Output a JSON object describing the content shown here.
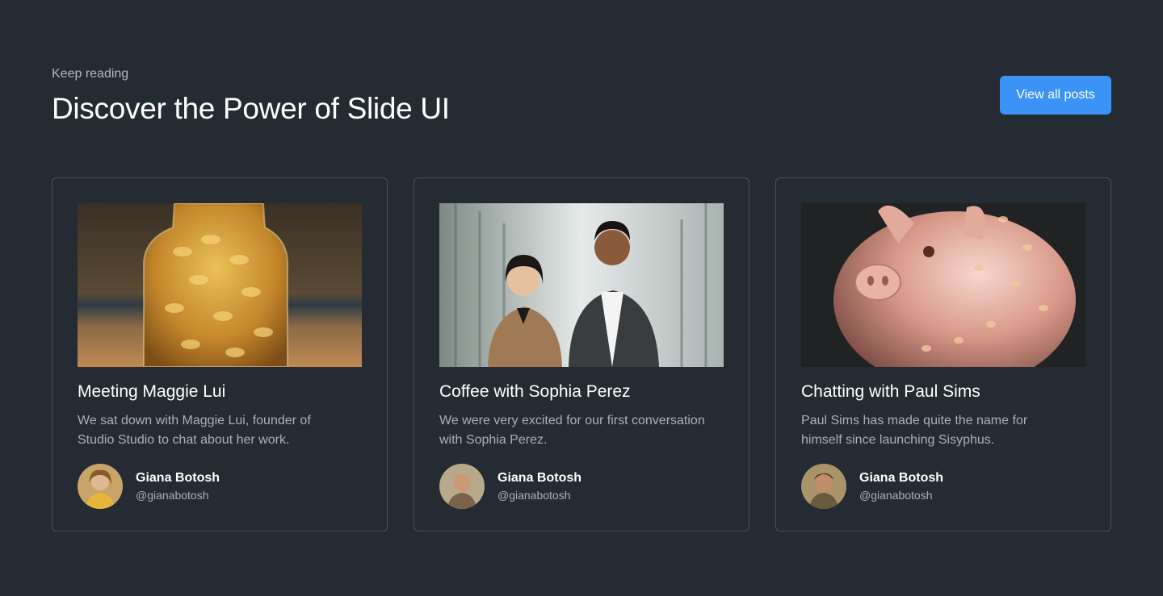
{
  "header": {
    "eyebrow": "Keep reading",
    "title": "Discover the Power of Slide UI",
    "view_all_label": "View all posts"
  },
  "colors": {
    "background": "#252b33",
    "accent": "#3b93f5",
    "card_border": "#4a5159",
    "muted_text": "#aab0b8"
  },
  "cards": [
    {
      "image": "coin-jar-photo",
      "title": "Meeting Maggie Lui",
      "description": "We sat down with Maggie Lui, founder of Studio Studio to chat about her work.",
      "author_name": "Giana Botosh",
      "author_handle": "@gianabotosh"
    },
    {
      "image": "business-people-photo",
      "title": "Coffee with Sophia Perez",
      "description": "We were very excited for our first conversation with Sophia Perez.",
      "author_name": "Giana Botosh",
      "author_handle": "@gianabotosh"
    },
    {
      "image": "piggy-bank-photo",
      "title": "Chatting with Paul Sims",
      "description": "Paul Sims has made quite the name for himself since launching Sisyphus.",
      "author_name": "Giana Botosh",
      "author_handle": "@gianabotosh"
    }
  ]
}
